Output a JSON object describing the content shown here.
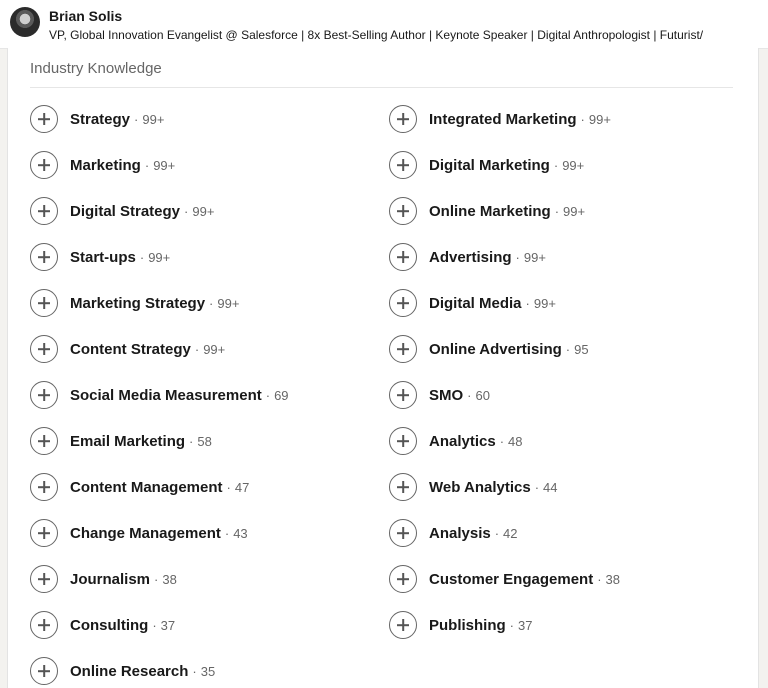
{
  "profile": {
    "name": "Brian Solis",
    "headline": "VP, Global Innovation Evangelist @ Salesforce | 8x Best-Selling Author | Keynote Speaker | Digital Anthropologist | Futurist/"
  },
  "section": {
    "title": "Industry Knowledge",
    "separator": "·"
  },
  "skills": [
    {
      "name": "Strategy",
      "count": "99+"
    },
    {
      "name": "Integrated Marketing",
      "count": "99+"
    },
    {
      "name": "Marketing",
      "count": "99+"
    },
    {
      "name": "Digital Marketing",
      "count": "99+"
    },
    {
      "name": "Digital Strategy",
      "count": "99+"
    },
    {
      "name": "Online Marketing",
      "count": "99+"
    },
    {
      "name": "Start-ups",
      "count": "99+"
    },
    {
      "name": "Advertising",
      "count": "99+"
    },
    {
      "name": "Marketing Strategy",
      "count": "99+"
    },
    {
      "name": "Digital Media",
      "count": "99+"
    },
    {
      "name": "Content Strategy",
      "count": "99+"
    },
    {
      "name": "Online Advertising",
      "count": "95"
    },
    {
      "name": "Social Media Measurement",
      "count": "69"
    },
    {
      "name": "SMO",
      "count": "60"
    },
    {
      "name": "Email Marketing",
      "count": "58"
    },
    {
      "name": "Analytics",
      "count": "48"
    },
    {
      "name": "Content Management",
      "count": "47"
    },
    {
      "name": "Web Analytics",
      "count": "44"
    },
    {
      "name": "Change Management",
      "count": "43"
    },
    {
      "name": "Analysis",
      "count": "42"
    },
    {
      "name": "Journalism",
      "count": "38"
    },
    {
      "name": "Customer Engagement",
      "count": "38"
    },
    {
      "name": "Consulting",
      "count": "37"
    },
    {
      "name": "Publishing",
      "count": "37"
    },
    {
      "name": "Online Research",
      "count": "35"
    }
  ]
}
